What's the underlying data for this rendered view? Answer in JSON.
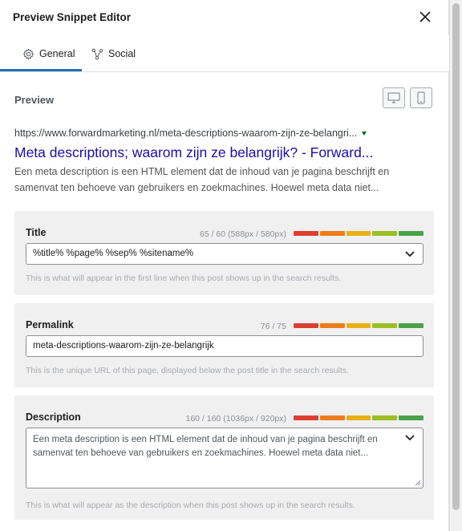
{
  "header": {
    "title": "Preview Snippet Editor"
  },
  "tabs": [
    {
      "label": "General",
      "active": true
    },
    {
      "label": "Social",
      "active": false
    }
  ],
  "preview": {
    "label": "Preview",
    "url": "https://www.forwardmarketing.nl/meta-descriptions-waarom-zijn-ze-belangri...",
    "title": "Meta descriptions; waarom zijn ze belangrijk? - Forward...",
    "description": "Een meta description is een HTML element dat de inhoud van je pagina beschrijft en samenvat ten behoeve van gebruikers en zoekmachines. Hoewel meta data niet..."
  },
  "fields": {
    "title": {
      "label": "Title",
      "count": "65 / 60 (588px / 580px)",
      "value": "%title% %page% %sep% %sitename%",
      "help": "This is what will appear in the first line when this post shows up in the search results."
    },
    "permalink": {
      "label": "Permalink",
      "count": "76 / 75",
      "value": "meta-descriptions-waarom-zijn-ze-belangrijk",
      "help": "This is the unique URL of this page, displayed below the post title in the search results."
    },
    "description": {
      "label": "Description",
      "count": "160 / 160 (1036px / 920px)",
      "value": "Een meta description is een HTML element dat de inhoud van je pagina beschrijft en samenvat ten behoeve van gebruikers en zoekmachines. Hoewel meta data niet...",
      "help": "This is what will appear as the description when this post shows up in the search results."
    }
  },
  "colors": {
    "accent": "#2271b1",
    "link": "#1a0dab",
    "bar_segments": [
      "#dd3f2f",
      "#ee7c1b",
      "#e8b016",
      "#9dbd24",
      "#4aa24a"
    ]
  },
  "icons": {
    "close": "close-icon",
    "general_tab": "gear-icon",
    "social_tab": "share-icon",
    "desktop": "desktop-icon",
    "mobile": "mobile-icon",
    "dropdown": "chevron-down-icon"
  }
}
